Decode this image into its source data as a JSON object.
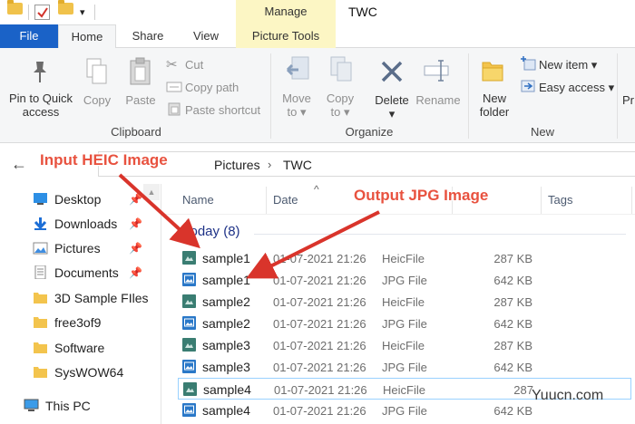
{
  "titlebar": {
    "context_tab": "Manage",
    "window_title": "TWC",
    "qa_menu_glyph": "▾"
  },
  "tabs": {
    "file": "File",
    "home": "Home",
    "share": "Share",
    "view": "View",
    "picture_tools": "Picture Tools"
  },
  "ribbon": {
    "clipboard": {
      "label": "Clipboard",
      "pin_line1": "Pin to Quick",
      "pin_line2": "access",
      "copy": "Copy",
      "paste": "Paste",
      "cut": "Cut",
      "copy_path": "Copy path",
      "paste_shortcut": "Paste shortcut"
    },
    "organize": {
      "label": "Organize",
      "move_line1": "Move",
      "move_line2": "to",
      "copy_line1": "Copy",
      "copy_line2": "to",
      "delete": "Delete",
      "rename": "Rename"
    },
    "new": {
      "label": "New",
      "new_folder_line1": "New",
      "new_folder_line2": "folder",
      "new_item": "New item",
      "easy_access": "Easy access",
      "cut_label": "Pr"
    }
  },
  "address": {
    "crumbs": [
      "Pictures",
      "TWC"
    ],
    "separator": "›"
  },
  "nav": {
    "items": [
      {
        "label": "Desktop",
        "pinned": true
      },
      {
        "label": "Downloads",
        "pinned": true
      },
      {
        "label": "Pictures",
        "pinned": true
      },
      {
        "label": "Documents",
        "pinned": true
      },
      {
        "label": "3D Sample FIles",
        "pinned": false
      },
      {
        "label": "free3of9",
        "pinned": false
      },
      {
        "label": "Software",
        "pinned": false
      },
      {
        "label": "SysWOW64",
        "pinned": false
      }
    ],
    "this_pc": "This PC"
  },
  "filelist": {
    "columns": {
      "name": "Name",
      "date": "Date",
      "tags": "Tags"
    },
    "group": "Today (8)",
    "rows": [
      {
        "name": "sample1",
        "date": "01-07-2021 21:26",
        "type": "HeicFile",
        "size": "287 KB",
        "kind": "heic"
      },
      {
        "name": "sample1",
        "date": "01-07-2021 21:26",
        "type": "JPG File",
        "size": "642 KB",
        "kind": "jpg"
      },
      {
        "name": "sample2",
        "date": "01-07-2021 21:26",
        "type": "HeicFile",
        "size": "287 KB",
        "kind": "heic"
      },
      {
        "name": "sample2",
        "date": "01-07-2021 21:26",
        "type": "JPG File",
        "size": "642 KB",
        "kind": "jpg"
      },
      {
        "name": "sample3",
        "date": "01-07-2021 21:26",
        "type": "HeicFile",
        "size": "287 KB",
        "kind": "heic"
      },
      {
        "name": "sample3",
        "date": "01-07-2021 21:26",
        "type": "JPG File",
        "size": "642 KB",
        "kind": "jpg"
      },
      {
        "name": "sample4",
        "date": "01-07-2021 21:26",
        "type": "HeicFile",
        "size": "287",
        "kind": "heic",
        "selected": true
      },
      {
        "name": "sample4",
        "date": "01-07-2021 21:26",
        "type": "JPG File",
        "size": "642 KB",
        "kind": "jpg"
      }
    ]
  },
  "annotations": {
    "input_label": "Input HEIC Image",
    "output_label": "Output JPG Image",
    "arrow_color": "#d9342b"
  },
  "watermark": "Yuucn.com",
  "colors": {
    "file_tab": "#1a62c7",
    "picture_tools": "#fcf6c4",
    "group_header": "#1e3287"
  }
}
